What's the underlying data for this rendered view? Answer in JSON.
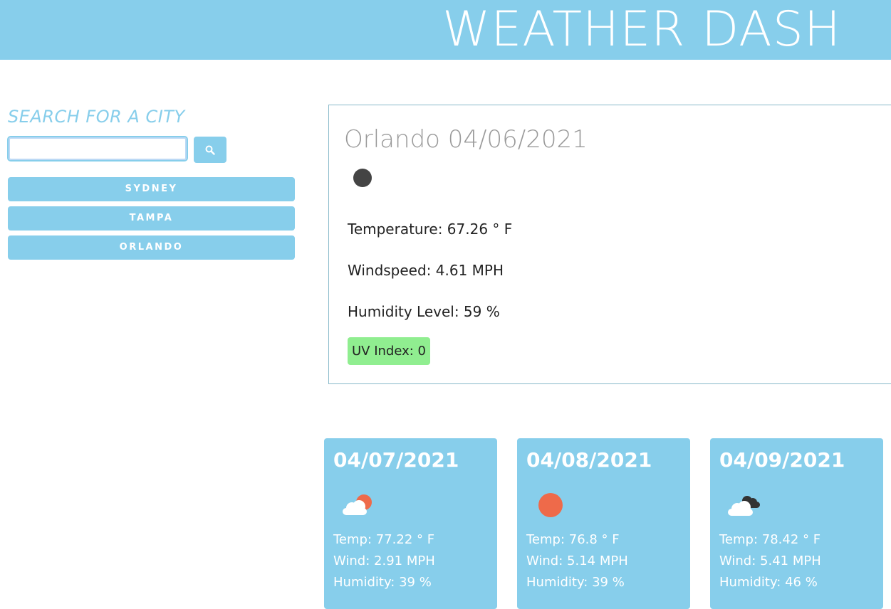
{
  "header": {
    "title": "WEATHER DASH"
  },
  "sidebar": {
    "heading": "SEARCH FOR A CITY",
    "search": {
      "value": "",
      "placeholder": ""
    },
    "search_button_icon": "search-icon",
    "cities": [
      {
        "label": "SYDNEY"
      },
      {
        "label": "TAMPA"
      },
      {
        "label": "ORLANDO"
      }
    ]
  },
  "current": {
    "title": "Orlando 04/06/2021",
    "icon": "moon-icon",
    "temperature": "Temperature: 67.26 ° F",
    "wind": "Windspeed: 4.61 MPH",
    "humidity": "Humidity Level: 59 %",
    "uv": "UV Index: 0",
    "uv_color": "#90ee90"
  },
  "forecast": [
    {
      "date": "04/07/2021",
      "icon": "partly-cloudy-icon",
      "temp": "Temp: 77.22 ° F",
      "wind": "Wind: 2.91 MPH",
      "humidity": "Humidity: 39 %"
    },
    {
      "date": "04/08/2021",
      "icon": "sun-icon",
      "temp": "Temp: 76.8 ° F",
      "wind": "Wind: 5.14 MPH",
      "humidity": "Humidity: 39 %"
    },
    {
      "date": "04/09/2021",
      "icon": "cloudy-icon",
      "temp": "Temp: 78.42 ° F",
      "wind": "Wind: 5.41 MPH",
      "humidity": "Humidity: 46 %"
    }
  ],
  "colors": {
    "accent": "#87ceeb",
    "sun": "#ee6a4a"
  }
}
